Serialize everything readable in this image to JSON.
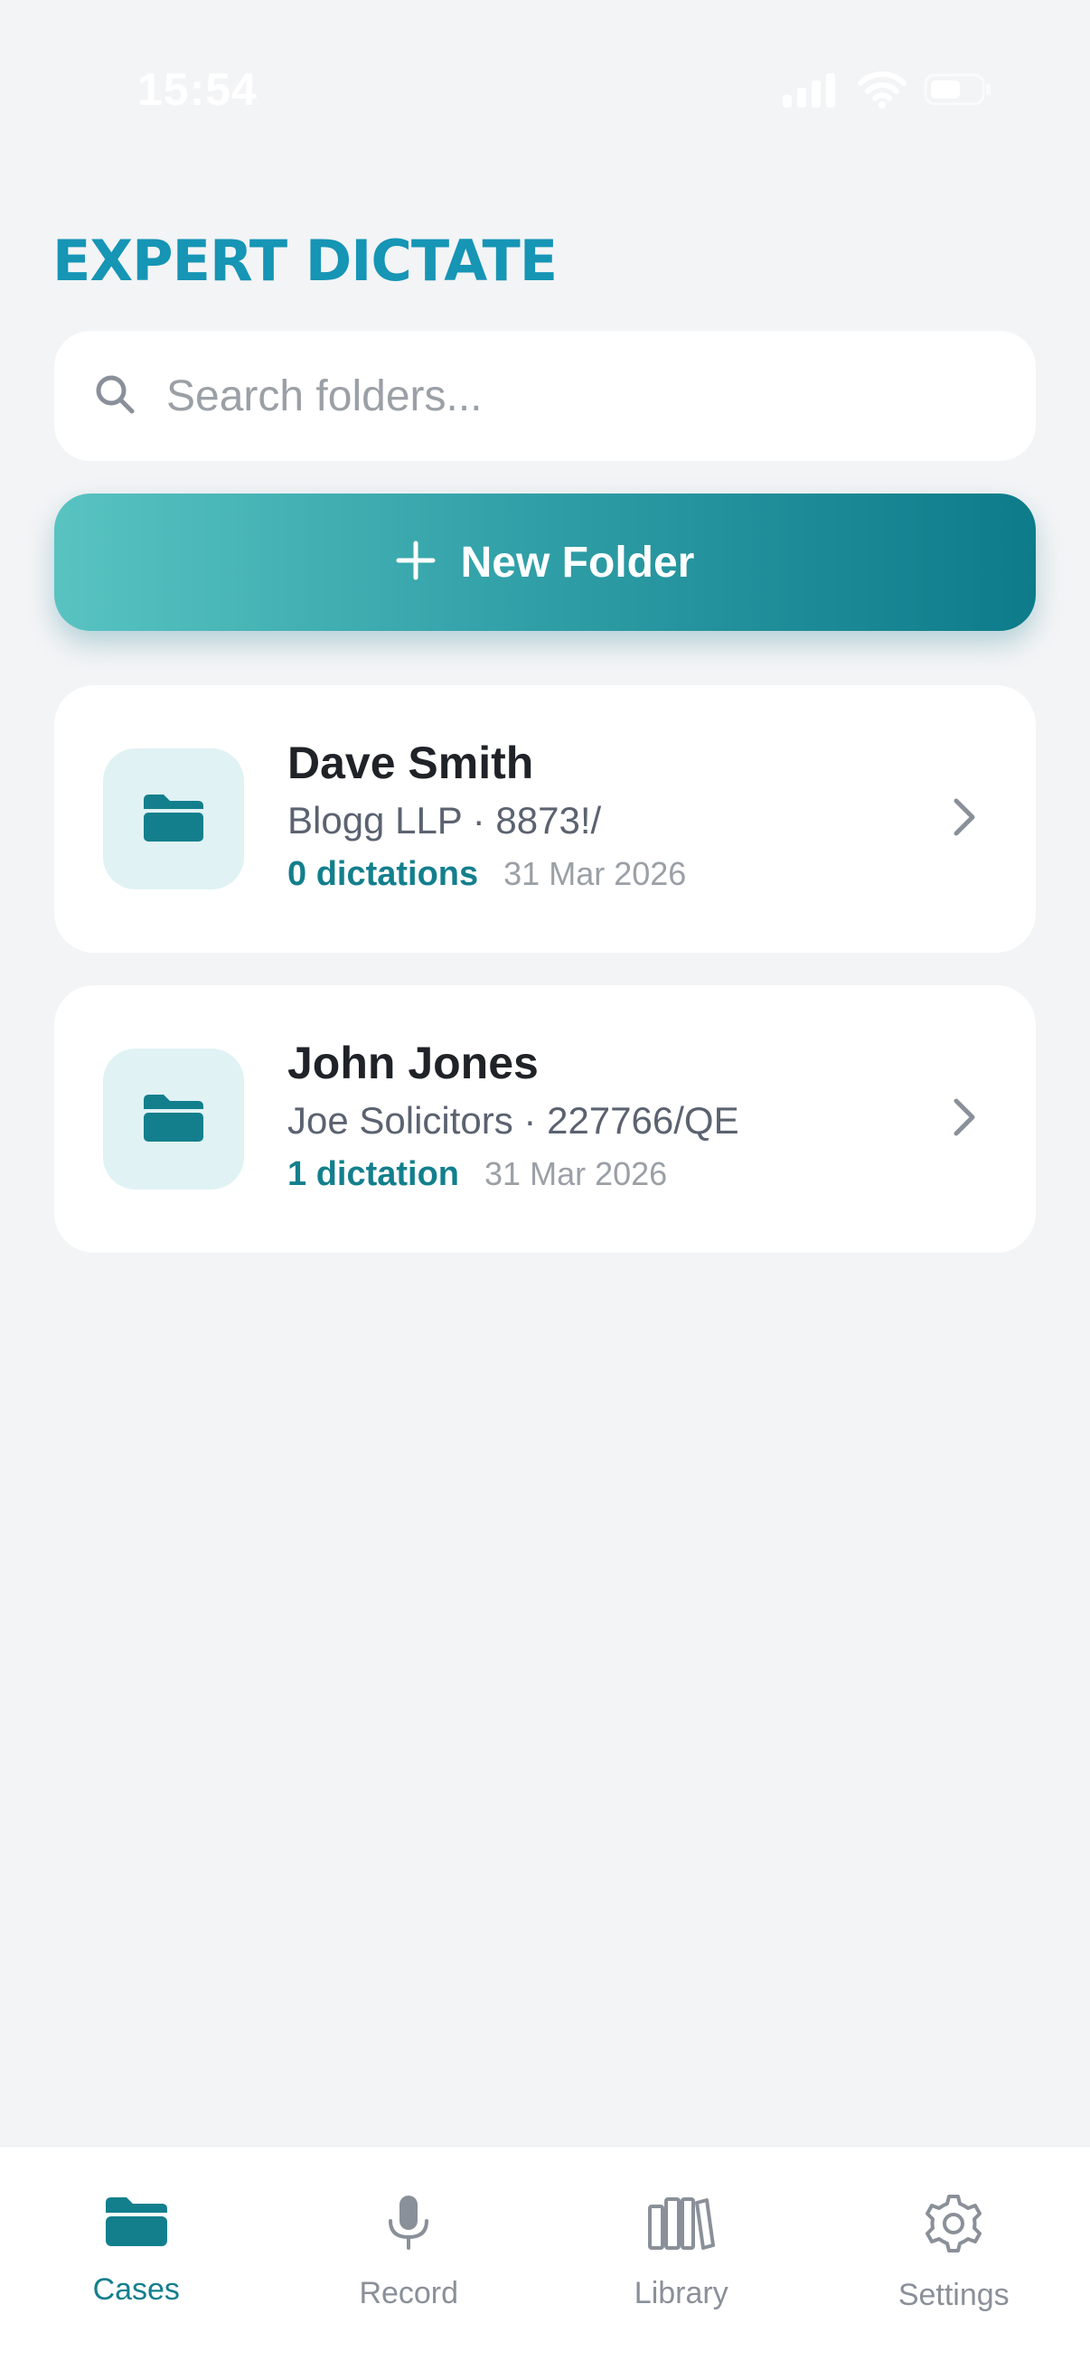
{
  "status_bar": {
    "time": "15:54"
  },
  "header": {
    "app_title": "EXPERT DICTATE"
  },
  "search": {
    "placeholder": "Search folders...",
    "value": ""
  },
  "actions": {
    "new_folder_label": "New Folder"
  },
  "folders": [
    {
      "name": "Dave Smith",
      "subtitle": "Blogg LLP · 8873!/",
      "count_label": "0 dictations",
      "date": "31 Mar 2026"
    },
    {
      "name": "John Jones",
      "subtitle": "Joe Solicitors · 227766/QE",
      "count_label": "1 dictation",
      "date": "31 Mar 2026"
    }
  ],
  "tabs": [
    {
      "label": "Cases",
      "icon": "folder-icon",
      "active": true
    },
    {
      "label": "Record",
      "icon": "microphone-icon",
      "active": false
    },
    {
      "label": "Library",
      "icon": "library-icon",
      "active": false
    },
    {
      "label": "Settings",
      "icon": "gear-icon",
      "active": false
    }
  ],
  "colors": {
    "brand": "#1695b5",
    "accent": "#137f8d",
    "background": "#f3f4f6",
    "muted": "#9aa0a6"
  }
}
